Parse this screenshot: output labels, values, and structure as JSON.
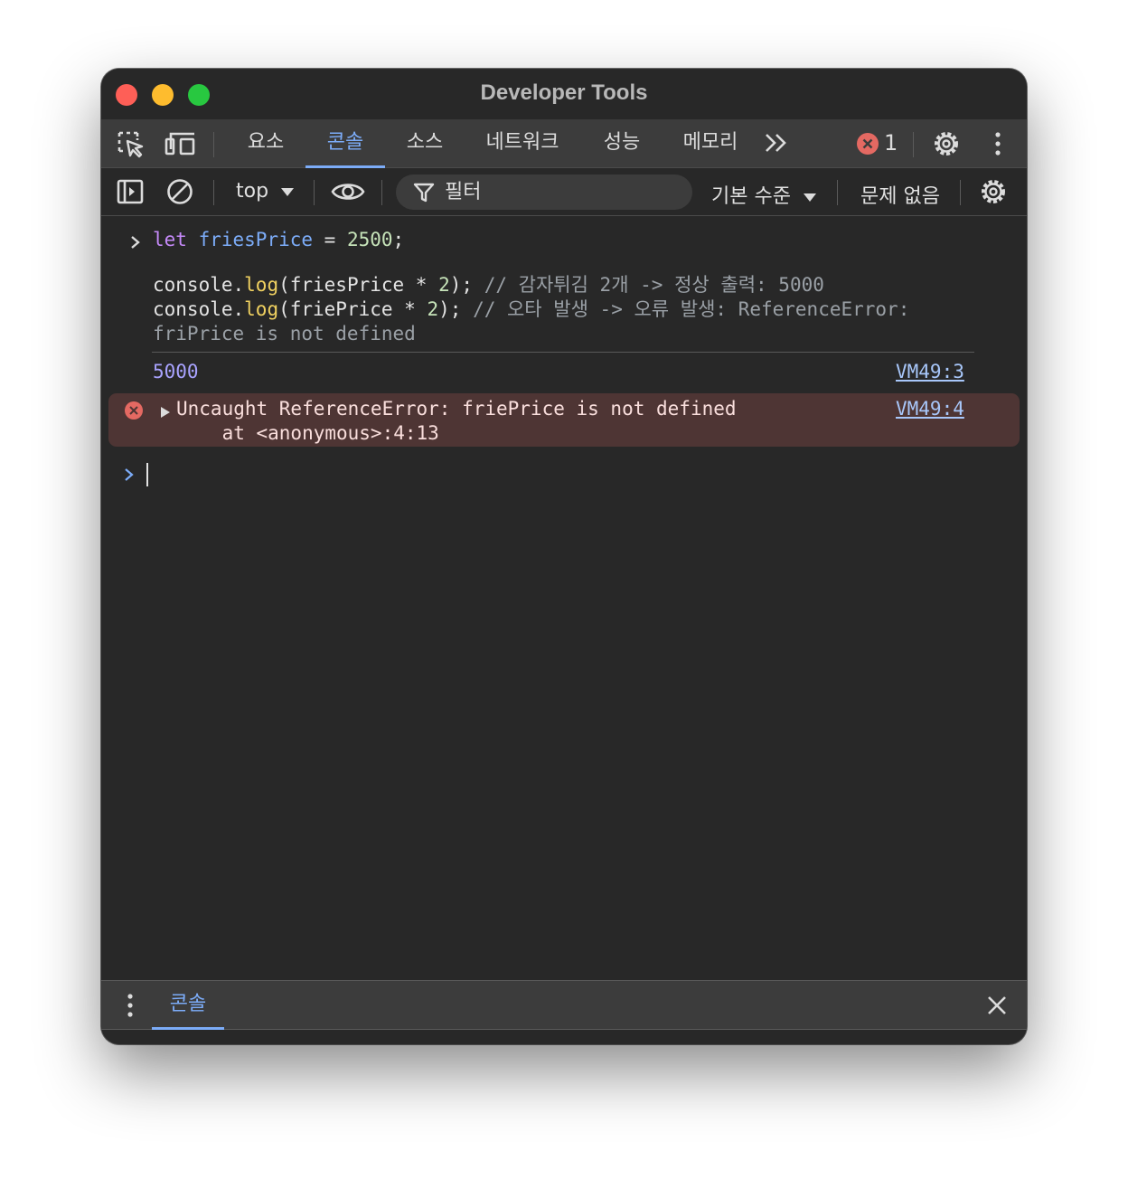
{
  "window": {
    "title": "Developer Tools"
  },
  "tabs": {
    "items": [
      "요소",
      "콘솔",
      "소스",
      "네트워크",
      "성능",
      "메모리"
    ],
    "active": "콘솔",
    "more": "»",
    "error_count": "1"
  },
  "toolbar": {
    "context": "top",
    "filter_placeholder": "필터",
    "level": "기본 수준",
    "issues": "문제 없음"
  },
  "console": {
    "input_lines": [
      {
        "prefix_kw": "let",
        "var": "friesPrice",
        "eq": " = ",
        "num": "2500",
        "end": ";"
      },
      {
        "obj": "console.",
        "fn": "log",
        "open": "(friesPrice * ",
        "num": "2",
        "close": "); ",
        "comment": "// 감자튀김 2개 -> 정상 출력: 5000"
      },
      {
        "obj": "console.",
        "fn": "log",
        "open": "(friePrice * ",
        "num": "2",
        "close": "); ",
        "comment": "// 오타 발생 -> 오류 발생: ReferenceError:"
      },
      {
        "comment": "friPrice is not defined"
      }
    ],
    "output": {
      "value": "5000",
      "source": "VM49:3"
    },
    "error": {
      "message": "Uncaught ReferenceError: friePrice is not defined",
      "stack": "    at <anonymous>:4:13",
      "source": "VM49:4"
    }
  },
  "drawer": {
    "tab": "콘솔"
  },
  "colors": {
    "background": "#282828",
    "accent": "#7cacf8",
    "error_bg": "#4e3534",
    "error_icon": "#e46962"
  }
}
